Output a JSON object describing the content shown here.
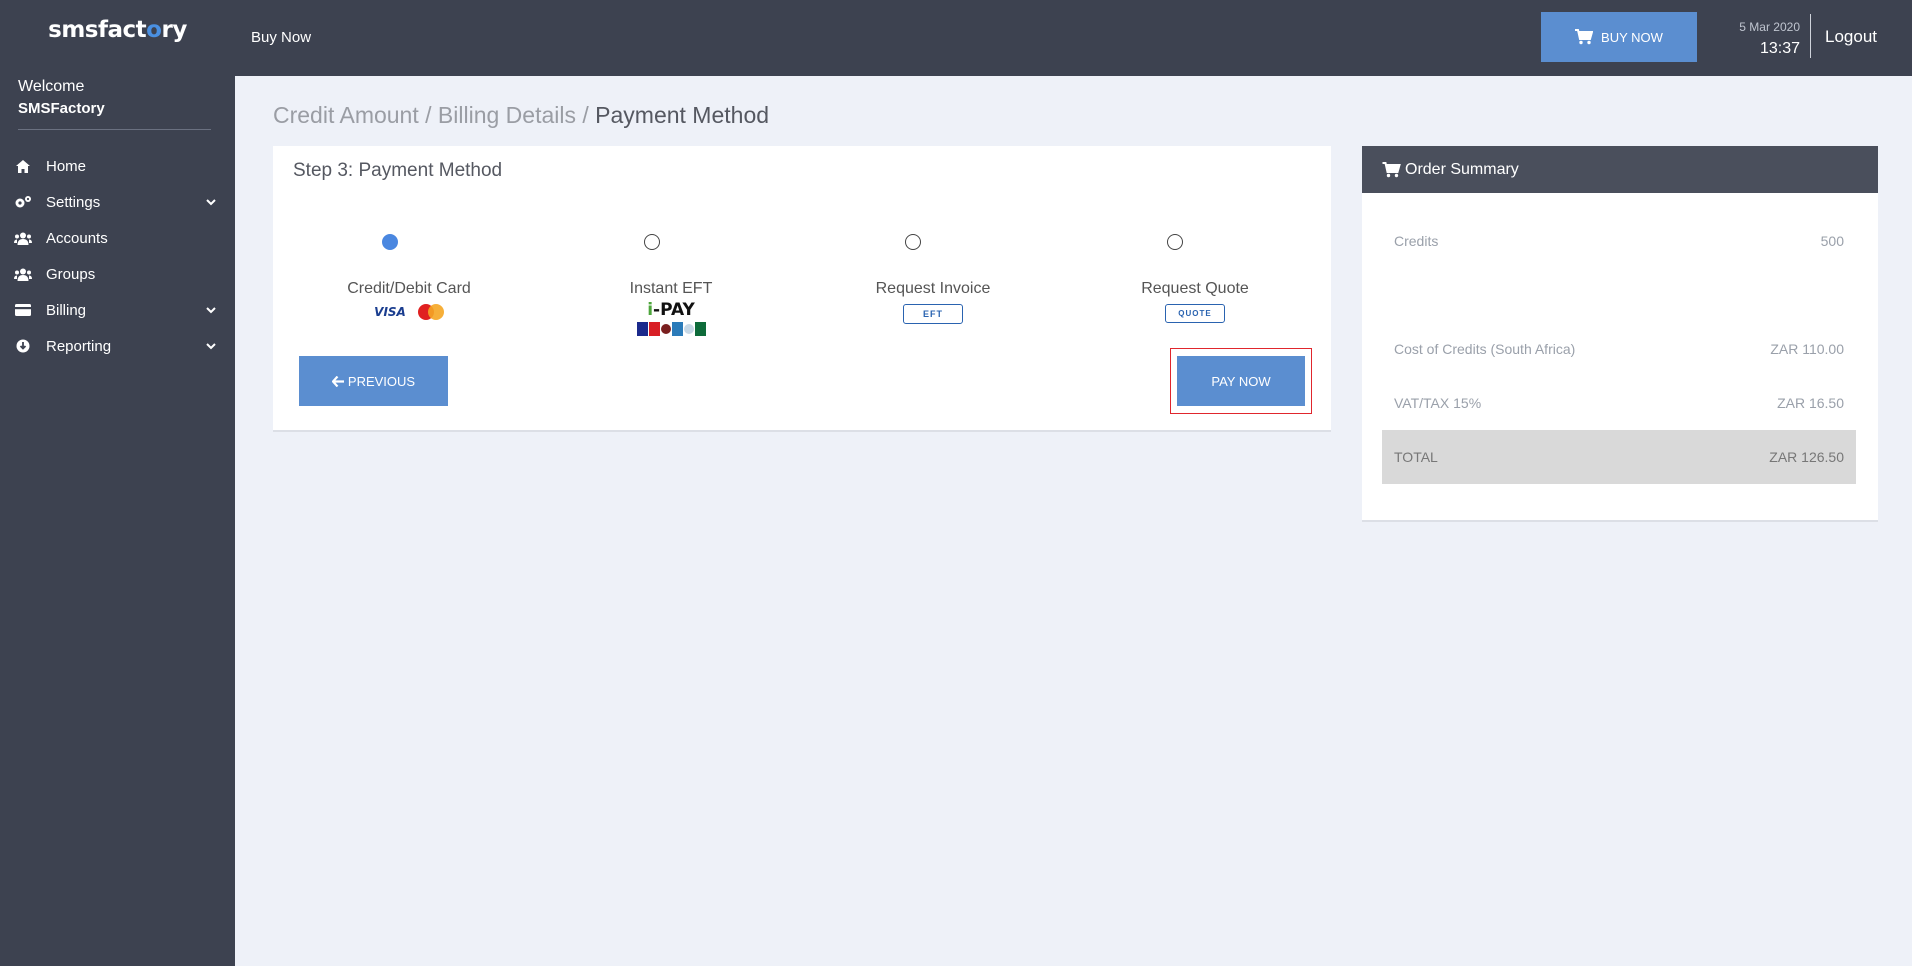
{
  "app": {
    "logo_prefix": "smsfact",
    "logo_o": "o",
    "logo_suffix": "ry"
  },
  "sidebar": {
    "welcome": "Welcome",
    "user": "SMSFactory",
    "items": [
      {
        "label": "Home",
        "icon": "home-icon"
      },
      {
        "label": "Settings",
        "icon": "cogs-icon",
        "expandable": true
      },
      {
        "label": "Accounts",
        "icon": "users-icon"
      },
      {
        "label": "Groups",
        "icon": "users-icon"
      },
      {
        "label": "Billing",
        "icon": "credit-card-icon",
        "expandable": true
      },
      {
        "label": "Reporting",
        "icon": "download-icon",
        "expandable": true
      }
    ]
  },
  "topbar": {
    "buy_link": "Buy Now",
    "buy_button": "BUY NOW",
    "date": "5 Mar 2020",
    "time": "13:37",
    "logout": "Logout"
  },
  "breadcrumb": {
    "step1": "Credit Amount",
    "step2": "Billing Details",
    "step3": "Payment Method",
    "sep": " / "
  },
  "payment": {
    "title": "Step 3: Payment Method",
    "options": [
      {
        "label": "Credit/Debit Card",
        "selected": true
      },
      {
        "label": "Instant EFT",
        "selected": false,
        "logo_i": "i",
        "logo_rest": "-PAY"
      },
      {
        "label": "Request Invoice",
        "selected": false,
        "badge": "EFT"
      },
      {
        "label": "Request Quote",
        "selected": false,
        "badge": "QUOTE"
      }
    ],
    "visa": "VISA",
    "previous_button": "PREVIOUS",
    "pay_button": "PAY NOW"
  },
  "summary": {
    "title": "Order Summary",
    "rows": [
      {
        "label": "Credits",
        "value": "500"
      },
      {
        "label": "Cost of Credits (South Africa)",
        "value": "ZAR 110.00"
      },
      {
        "label": "VAT/TAX 15%",
        "value": "ZAR 16.50"
      },
      {
        "label": "TOTAL",
        "value": "ZAR 126.50"
      }
    ]
  },
  "colors": {
    "sidebar": "#3d4250",
    "accent": "#5b8ed0",
    "highlight_border": "#e0262d",
    "background": "#eef1f8"
  }
}
